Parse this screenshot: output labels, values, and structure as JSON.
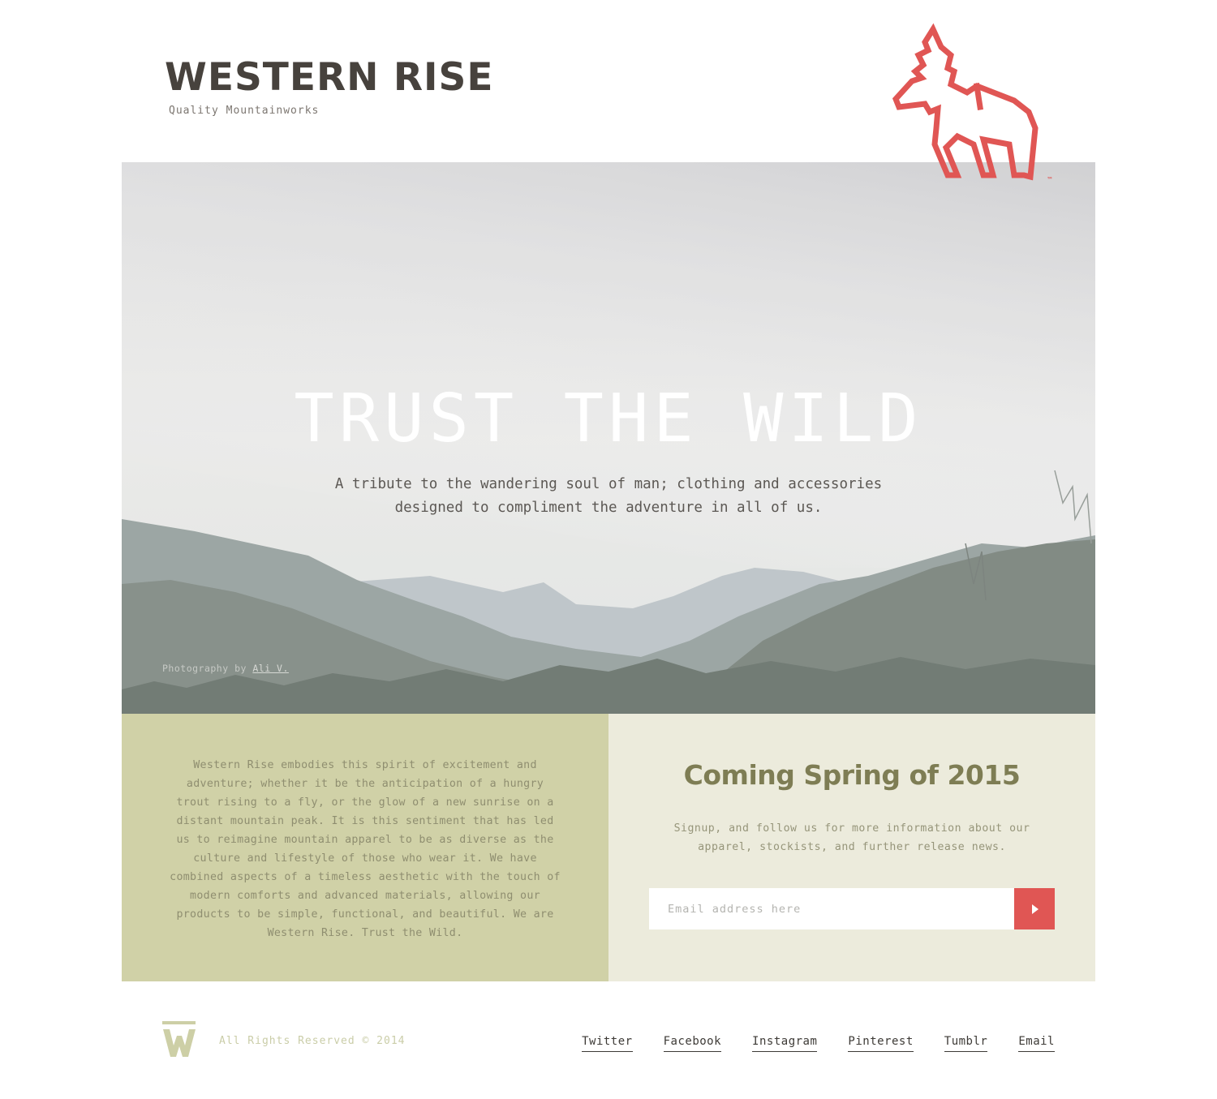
{
  "header": {
    "brand_name": "WESTERN RISE",
    "trademark": "™",
    "tagline": "Quality Mountainworks",
    "logo_icon": "moose-icon",
    "accent_color": "#e05654"
  },
  "hero": {
    "title": "TRUST THE WILD",
    "subtitle": "A tribute to the wandering soul of man; clothing and accessories designed to compliment the adventure in all of us.",
    "photo_credit_prefix": "Photography by ",
    "photo_credit_link": "Ali V."
  },
  "about": {
    "text": "Western Rise embodies this spirit of excitement and adventure; whether it be the anticipation of a hungry trout rising to a fly, or the glow of a new sunrise on a distant mountain peak. It is this sentiment that has led us to reimagine mountain apparel to be as diverse as the culture and lifestyle of those who wear it. We have combined aspects of a timeless aesthetic with the touch of modern comforts and advanced materials, allowing our products to be simple, functional, and beautiful. We are Western Rise. Trust the Wild."
  },
  "signup": {
    "heading": "Coming Spring of 2015",
    "text": "Signup, and follow us for more information about our apparel, stockists, and further release news.",
    "email_placeholder": "Email address here",
    "email_value": "",
    "submit_icon": "play-icon"
  },
  "footer": {
    "logo_icon": "w-logo-icon",
    "copyright": "All Rights Reserved © 2014",
    "links": [
      "Twitter",
      "Facebook",
      "Instagram",
      "Pinterest",
      "Tumblr",
      "Email"
    ]
  }
}
